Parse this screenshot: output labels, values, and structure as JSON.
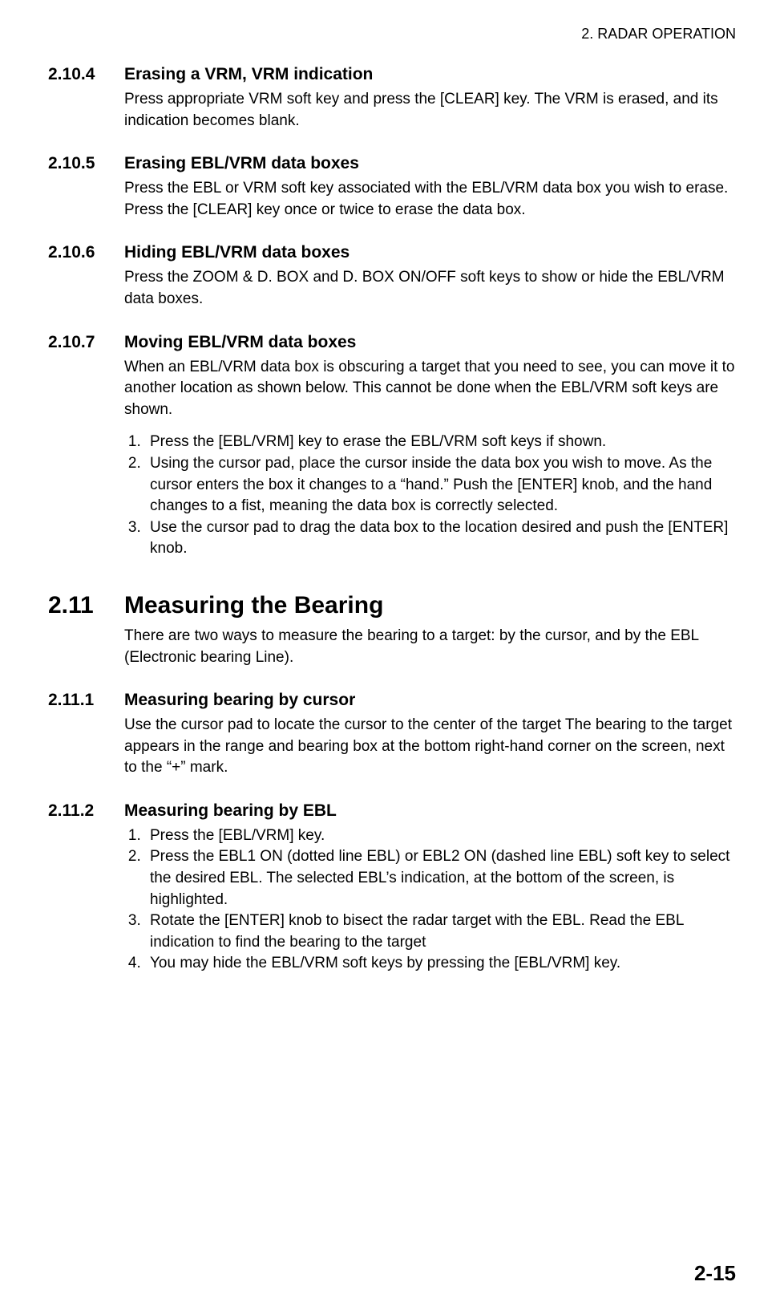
{
  "header": {
    "chapter": "2. RADAR OPERATION"
  },
  "s4": {
    "num": "2.10.4",
    "title": "Erasing a VRM, VRM indication",
    "body": "Press appropriate VRM soft key and press the [CLEAR] key. The VRM is erased, and its indication becomes blank."
  },
  "s5": {
    "num": "2.10.5",
    "title": "Erasing EBL/VRM data boxes",
    "body": "Press the EBL or VRM soft key associated with the EBL/VRM data box you wish to erase. Press the [CLEAR] key once or twice to erase the data box."
  },
  "s6": {
    "num": "2.10.6",
    "title": "Hiding EBL/VRM data boxes",
    "body": "Press the ZOOM & D. BOX and D. BOX ON/OFF soft keys to show or hide the EBL/VRM data boxes."
  },
  "s7": {
    "num": "2.10.7",
    "title": "Moving EBL/VRM data boxes",
    "body": "When an EBL/VRM data box is obscuring a target that you need to see, you can move it to another location as shown below. This cannot be done when the EBL/VRM soft keys are shown.",
    "steps": [
      "Press the [EBL/VRM] key to erase the EBL/VRM soft keys if shown.",
      "Using the cursor pad, place the cursor inside the data box you wish to move. As the cursor enters the box it changes to a “hand.” Push the [ENTER] knob, and the hand changes to a fist, meaning the data box is correctly selected.",
      "Use the cursor pad to drag the data box to the location desired and push the [ENTER] knob."
    ]
  },
  "s11": {
    "num": "2.11",
    "title": "Measuring the Bearing",
    "body": "There are two ways to measure the bearing to a target: by the cursor, and by the EBL (Electronic bearing Line)."
  },
  "s111": {
    "num": "2.11.1",
    "title": "Measuring bearing by cursor",
    "body": "Use the cursor pad to locate the cursor to the center of the target The bearing to the target appears in the range and bearing box at the bottom right-hand corner on the screen, next to the “+” mark."
  },
  "s112": {
    "num": "2.11.2",
    "title": "Measuring bearing by EBL",
    "steps": [
      "Press the [EBL/VRM] key.",
      "Press the EBL1 ON (dotted line EBL) or EBL2 ON (dashed line EBL) soft key to select the desired EBL. The selected EBL’s indication, at the bottom of the screen, is highlighted.",
      "Rotate the [ENTER] knob to bisect the radar target with the EBL. Read the EBL indication to find the bearing to the target",
      "You may hide the EBL/VRM soft keys by pressing the [EBL/VRM] key."
    ]
  },
  "pageNumber": "2-15"
}
